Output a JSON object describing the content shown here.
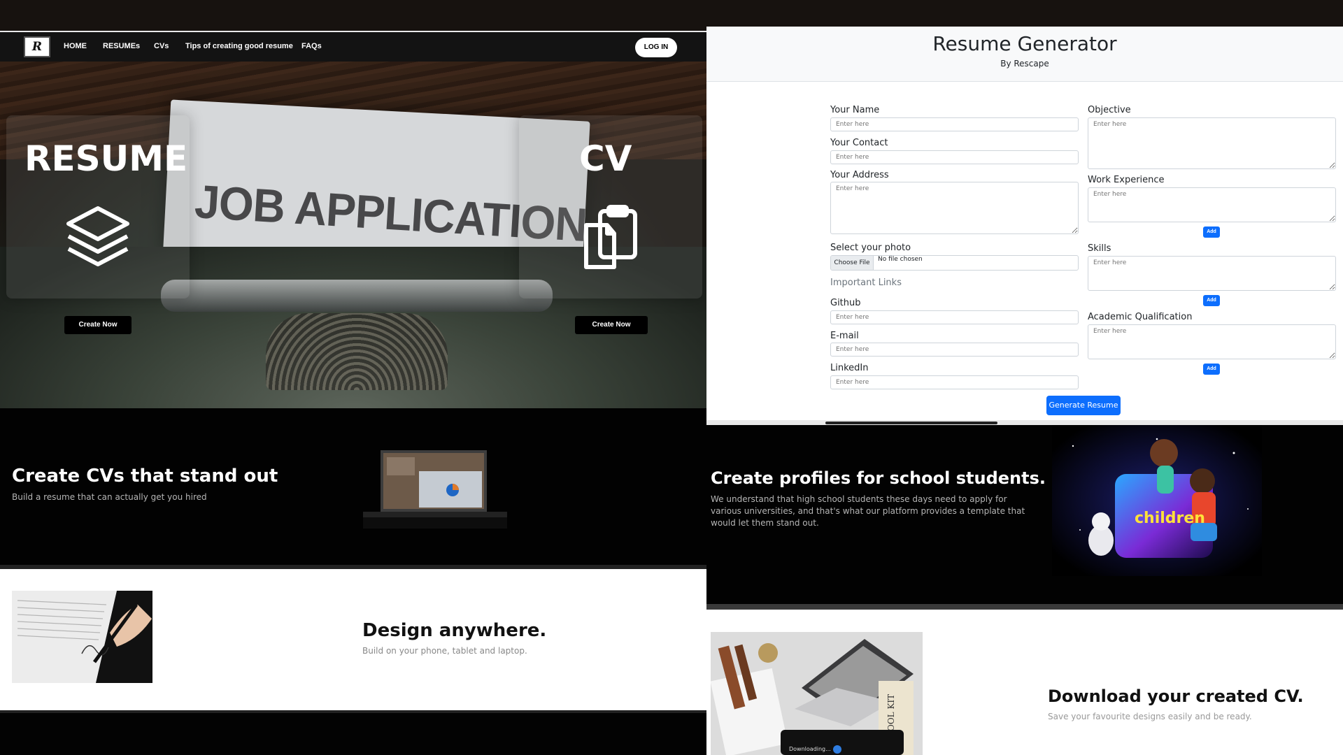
{
  "left_site": {
    "nav": {
      "logo_text": "R",
      "links": [
        "HOME",
        "RESUMEs",
        "CVs",
        "Tips of creating good resume",
        "FAQs"
      ],
      "login_label": "LOG IN"
    },
    "hero": {
      "typewriter_text": "JOB APPLICATION",
      "resume_card": {
        "title": "RESUME",
        "icon": "layers-icon",
        "button": "Create Now"
      },
      "cv_card": {
        "title": "CV",
        "icon": "clipboard-icon",
        "button": "Create Now"
      }
    },
    "section1": {
      "title": "Create CVs that stand out",
      "subtitle": "Build a resume that can actually get you hired"
    },
    "section2": {
      "title": "Design anywhere.",
      "subtitle": "Build on your phone, tablet and laptop."
    }
  },
  "right_site": {
    "generator": {
      "title": "Resume Generator",
      "subtitle": "By Rescape",
      "placeholder": "Enter here",
      "left_fields": {
        "name": "Your Name",
        "contact": "Your Contact",
        "address": "Your Address",
        "photo": "Select your photo",
        "choose_file": "Choose File",
        "no_file": "No file chosen",
        "important_links": "Important Links",
        "github": "Github",
        "email": "E-mail",
        "linkedin": "LinkedIn"
      },
      "right_fields": {
        "objective": "Objective",
        "work": "Work Experience",
        "skills": "Skills",
        "academic": "Academic Qualification",
        "add_label": "Add"
      },
      "generate_button": "Generate Resume"
    },
    "section3": {
      "title": "Create profiles for school students.",
      "body": "We understand that high school students these days need to apply for various universities, and that's what our platform provides a template that would let them stand out.",
      "image_text": "children"
    },
    "section4": {
      "title": "Download your created CV.",
      "subtitle": "Save your favourite designs easily and be ready.",
      "image_caption": "Downloading..."
    }
  },
  "colors": {
    "primary": "#0d6efd",
    "dark_band": "#020202",
    "nav_bg": "#131313"
  }
}
